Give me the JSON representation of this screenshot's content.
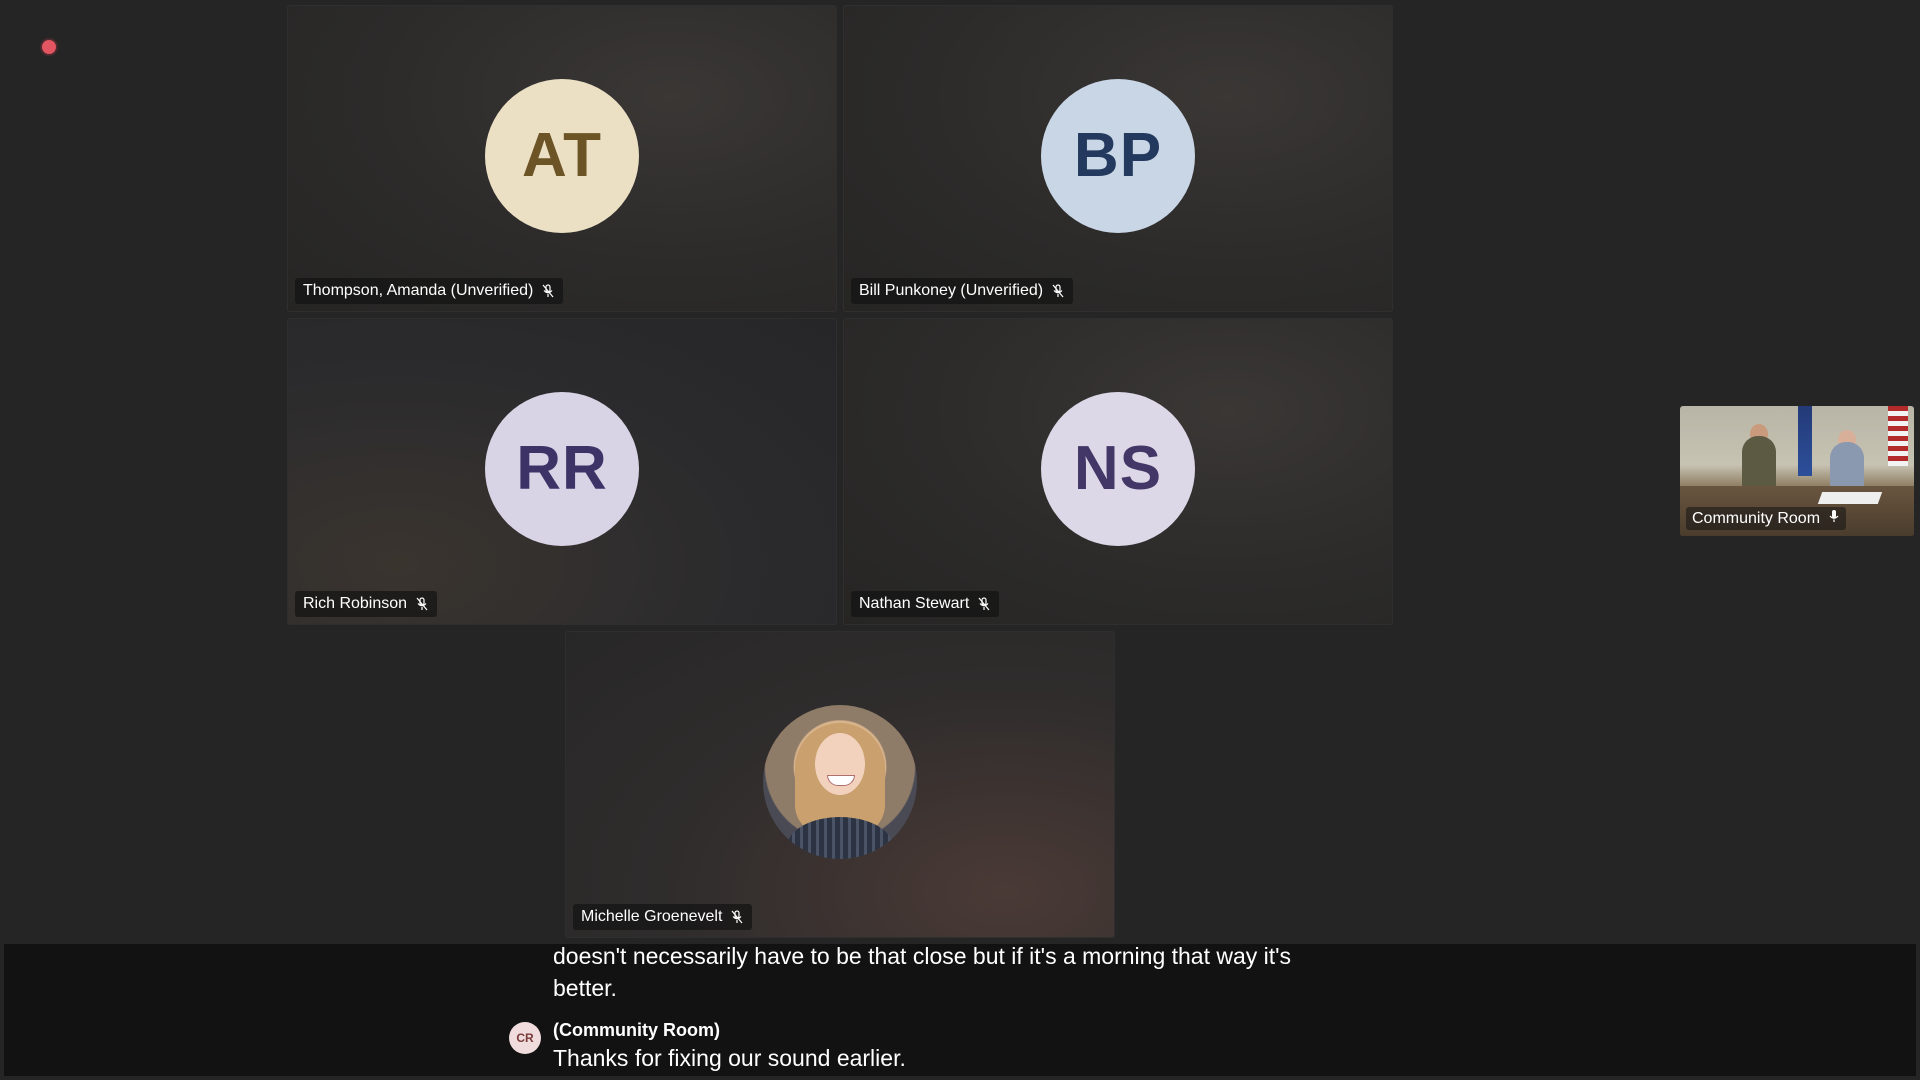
{
  "meeting": {
    "recording_indicator": "recording-dot-icon"
  },
  "participants": [
    {
      "initials": "AT",
      "name": "Thompson, Amanda (Unverified)",
      "mic": "mic-off-icon"
    },
    {
      "initials": "BP",
      "name": "Bill Punkoney (Unverified)",
      "mic": "mic-off-icon"
    },
    {
      "initials": "RR",
      "name": "Rich Robinson",
      "mic": "mic-off-icon"
    },
    {
      "initials": "NS",
      "name": "Nathan Stewart",
      "mic": "mic-off-icon"
    },
    {
      "initials": "",
      "name": "Michelle Groenevelt",
      "mic": "mic-off-icon"
    }
  ],
  "room": {
    "name": "Community Room",
    "mic": "mic-on-icon"
  },
  "captions": {
    "previous_text": "doesn't necessarily have to be that close but if it's a morning that way it's better.",
    "speaker_initials": "CR",
    "speaker": "(Community Room)",
    "text": "Thanks for fixing our sound earlier."
  },
  "colors": {
    "background": "#252525",
    "caption_bar": "#121212",
    "recording": "#e25561"
  }
}
